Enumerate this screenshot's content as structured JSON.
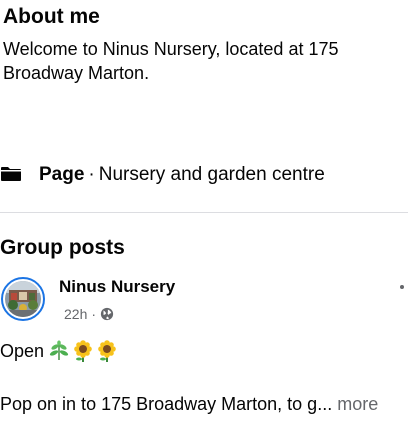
{
  "about": {
    "title": "About me",
    "text": "Welcome to Ninus Nursery, located at 175 Broadway Marton."
  },
  "page_info": {
    "icon": "flag-icon",
    "label": "Page",
    "separator": "·",
    "category": "Nursery and garden centre"
  },
  "group_posts": {
    "title": "Group posts",
    "post": {
      "author": "Ninus Nursery",
      "time": "22h",
      "separator": "·",
      "visibility_icon": "globe-icon",
      "open_text": "Open",
      "emojis": [
        "herb-icon",
        "sunflower-icon",
        "sunflower-icon"
      ],
      "body": "Pop on in to 175 Broadway Marton, to g...",
      "see_more": "more"
    }
  },
  "colors": {
    "text": "#050505",
    "secondary_text": "#65676b",
    "divider": "#dcdde1",
    "avatar_ring": "#1b74e4"
  }
}
